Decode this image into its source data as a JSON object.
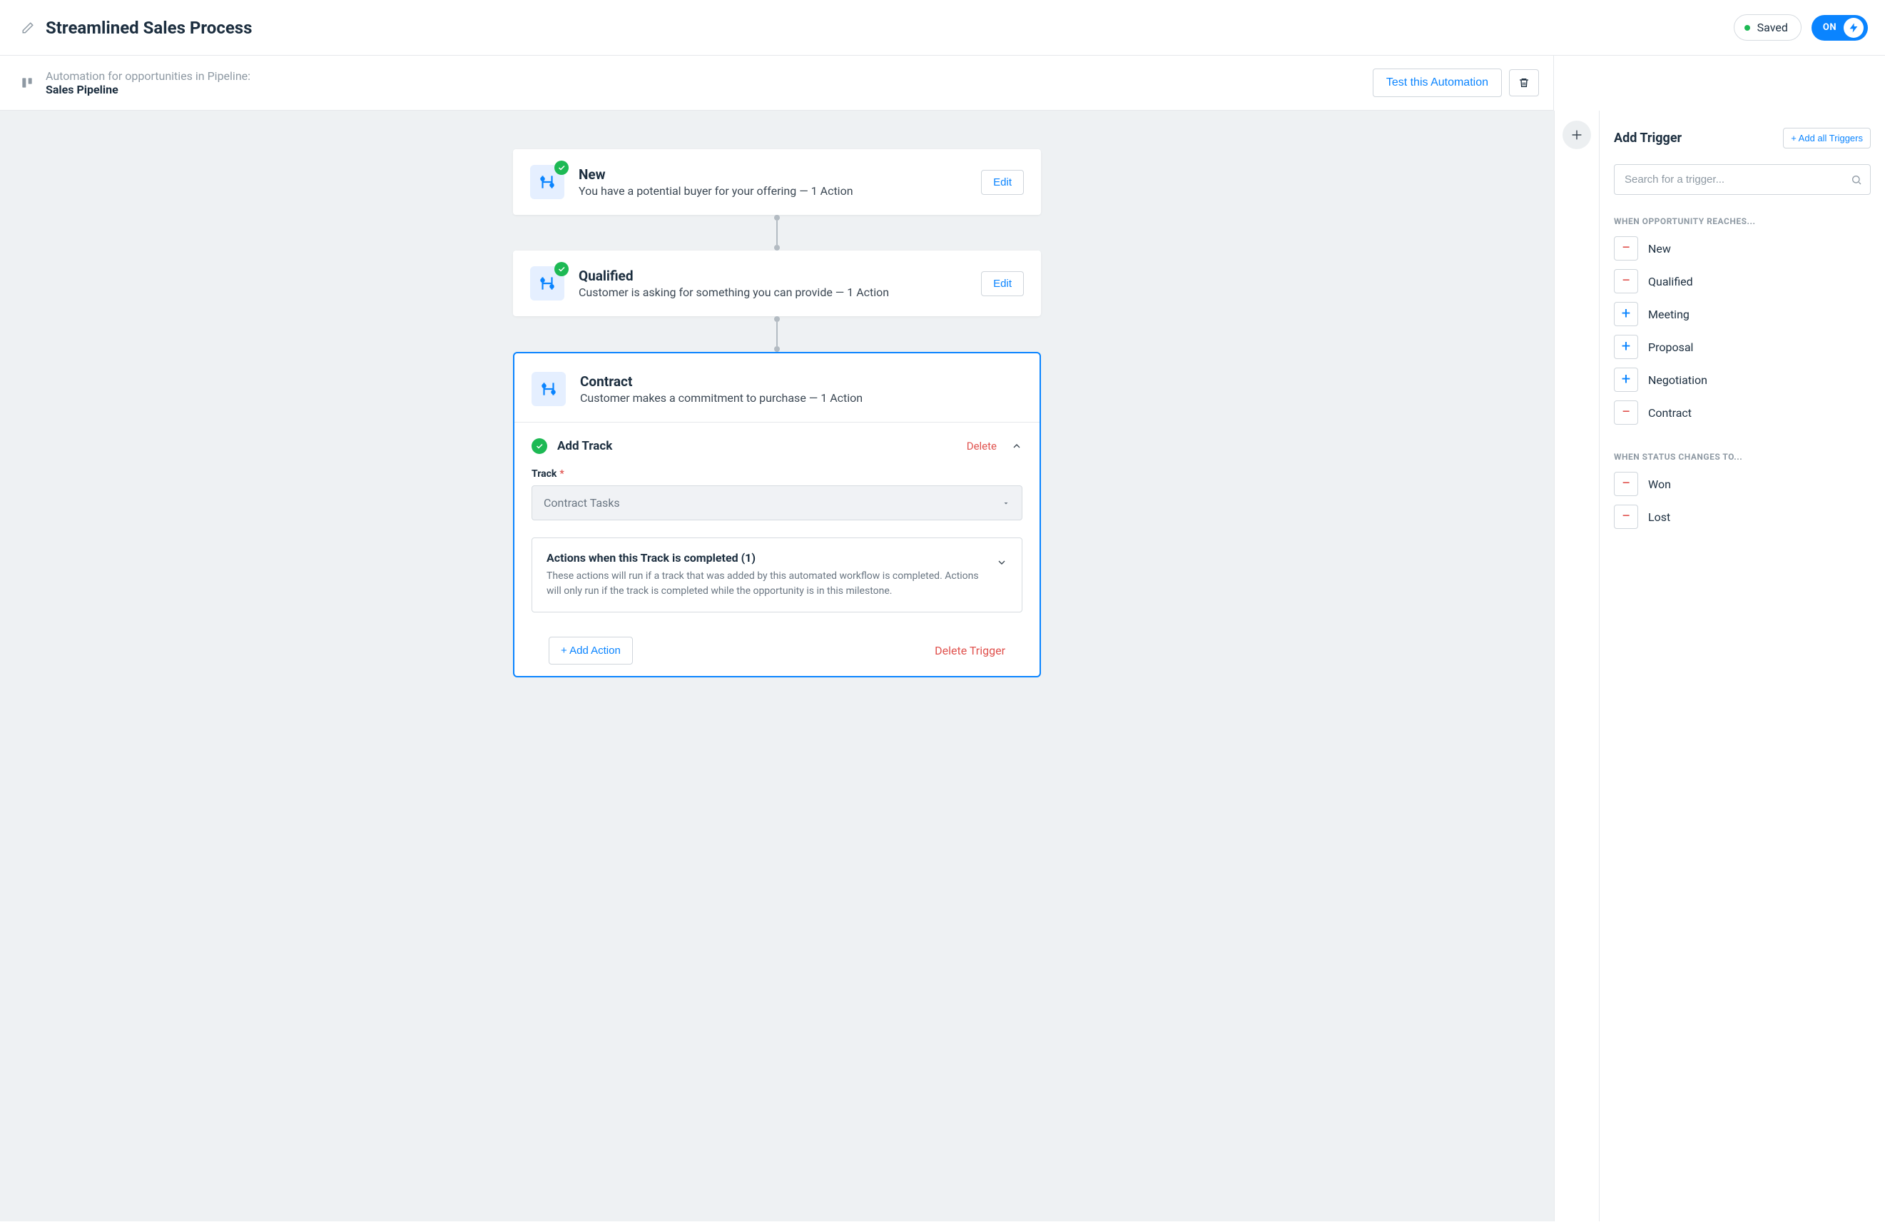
{
  "header": {
    "title": "Streamlined Sales Process",
    "saved_label": "Saved",
    "on_label": "ON"
  },
  "subheader": {
    "context_line": "Automation for opportunities in Pipeline:",
    "pipeline_name": "Sales Pipeline",
    "test_button": "Test this Automation"
  },
  "flow": {
    "cards": [
      {
        "title": "New",
        "subtitle": "You have a potential buyer for your offering — 1 Action",
        "edit_label": "Edit",
        "has_check": true
      },
      {
        "title": "Qualified",
        "subtitle": "Customer is asking for something you can provide — 1 Action",
        "edit_label": "Edit",
        "has_check": true
      }
    ]
  },
  "expanded": {
    "title": "Contract",
    "subtitle": "Customer makes a commitment to purchase — 1 Action",
    "section_title": "Add Track",
    "delete_label": "Delete",
    "field_track_label": "Track",
    "track_value": "Contract Tasks",
    "actions_box_title": "Actions when this Track is completed (1)",
    "actions_box_desc": "These actions will run if a track that was added by this automated workflow is completed. Actions will only run if the track is completed while the opportunity is in this milestone.",
    "add_action_label": "+ Add Action",
    "delete_trigger_label": "Delete Trigger"
  },
  "panel": {
    "title": "Add Trigger",
    "add_all_label": "+ Add all Triggers",
    "search_placeholder": "Search for a trigger...",
    "group_reaches": "WHEN OPPORTUNITY REACHES...",
    "group_status": "WHEN STATUS CHANGES TO...",
    "reaches_items": [
      {
        "label": "New",
        "state": "minus"
      },
      {
        "label": "Qualified",
        "state": "minus"
      },
      {
        "label": "Meeting",
        "state": "plus"
      },
      {
        "label": "Proposal",
        "state": "plus"
      },
      {
        "label": "Negotiation",
        "state": "plus"
      },
      {
        "label": "Contract",
        "state": "minus"
      }
    ],
    "status_items": [
      {
        "label": "Won",
        "state": "minus"
      },
      {
        "label": "Lost",
        "state": "minus"
      }
    ]
  }
}
